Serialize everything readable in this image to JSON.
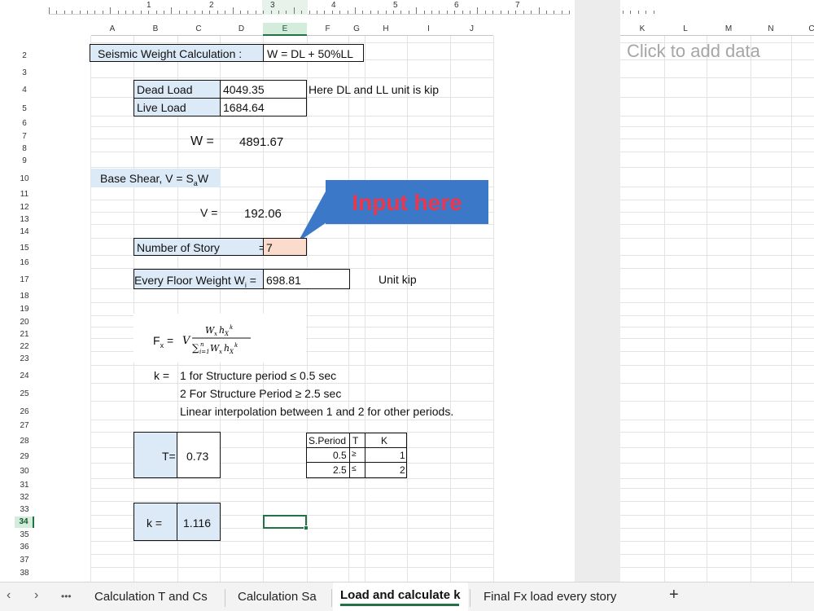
{
  "ruler": {
    "numbers": [
      "1",
      "2",
      "3",
      "4",
      "5",
      "6",
      "7"
    ]
  },
  "columns": [
    "A",
    "B",
    "C",
    "D",
    "E",
    "F",
    "G",
    "H",
    "I",
    "J",
    "K",
    "L",
    "M",
    "N",
    "C"
  ],
  "rows": [
    "2",
    "3",
    "4",
    "5",
    "6",
    "7",
    "8",
    "9",
    "10",
    "11",
    "12",
    "13",
    "14",
    "15",
    "16",
    "17",
    "18",
    "19",
    "20",
    "21",
    "22",
    "23",
    "24",
    "25",
    "26",
    "27",
    "28",
    "29",
    "30",
    "31",
    "32",
    "33",
    "34",
    "35",
    "36",
    "37",
    "38"
  ],
  "selected_row": "34",
  "selected_col": "E",
  "add_data_placeholder": "Click to add data",
  "content": {
    "seismic_label": "Seismic Weight Calculation :",
    "seismic_formula": "W = DL + 50%LL",
    "dead_load_label": "Dead Load",
    "dead_load_value": "4049.35",
    "unit_note": "Here DL and LL unit is kip",
    "live_load_label": "Live Load",
    "live_load_value": "1684.64",
    "w_label": "W =",
    "w_value": "4891.67",
    "base_shear_label": "Base Shear, V = S",
    "base_shear_sub": "a",
    "base_shear_tail": "W",
    "v_label": "V =",
    "v_value": "192.06",
    "callout_text": "Input here",
    "story_label": "Number of Story",
    "story_eq": "=",
    "story_value": "7",
    "floor_weight_label": "Every Floor Weight W",
    "floor_weight_sub": "i",
    "floor_weight_eq": " =",
    "floor_weight_value": "698.81",
    "floor_weight_unit": "Unit kip",
    "fx_label": "F",
    "fx_sub": "x",
    "fx_eq": " =",
    "k_label": "k =",
    "k_line1": "1 for Structure period ≤ 0.5 sec",
    "k_line2": "2 For Structure Period ≥ 2.5 sec",
    "k_line3": "Linear interpolation between 1 and 2 for other periods.",
    "t_label": "T=",
    "t_value": "0.73",
    "k_result_label": "k =",
    "k_result_value": "1.116",
    "table": {
      "headers": [
        "S.Period",
        "T",
        "K"
      ],
      "rows": [
        [
          "0.5",
          "≥",
          "1"
        ],
        [
          "2.5",
          "≤",
          "2"
        ]
      ]
    }
  },
  "tabs": {
    "more": "•••",
    "items": [
      "Calculation T and Cs",
      "Calculation Sa",
      "Load and calculate k",
      "Final Fx load every story"
    ],
    "active_index": 2,
    "add": "+"
  },
  "colors": {
    "accent": "#217346",
    "callout": "#3b78c8",
    "callout_text": "#e8384f",
    "highlight_blue": "#dce9f7",
    "highlight_peach": "#fadbcc"
  }
}
